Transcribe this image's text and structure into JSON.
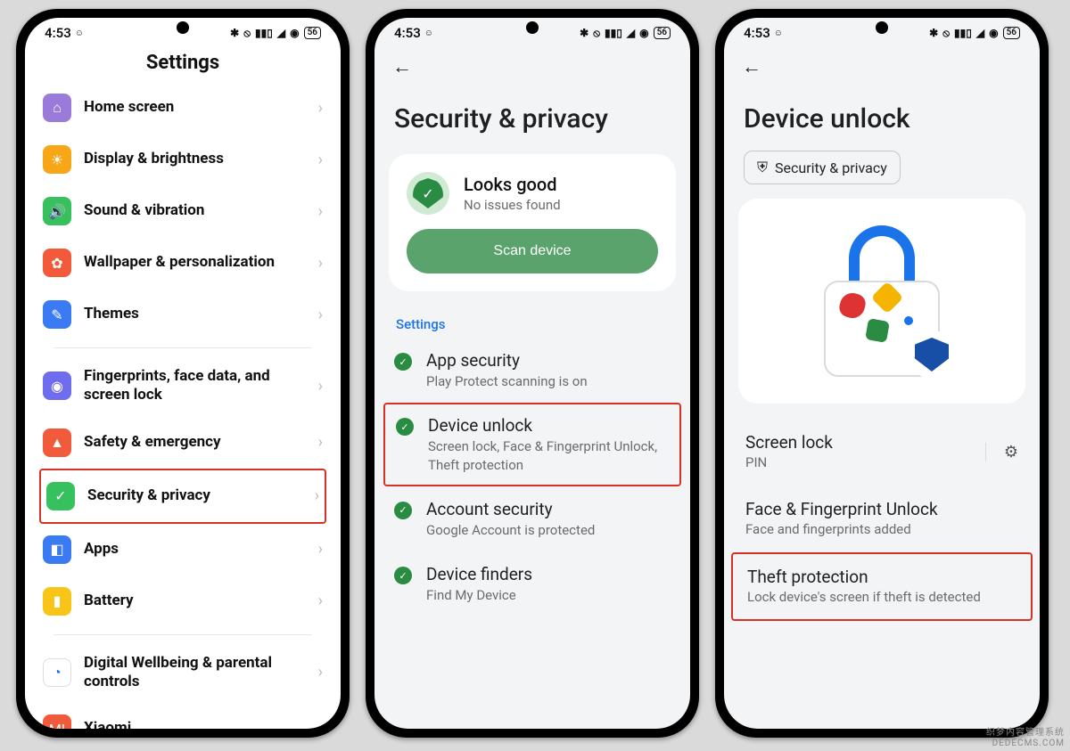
{
  "status": {
    "time": "4:53",
    "battery": "56"
  },
  "screen1": {
    "title": "Settings",
    "items": [
      {
        "label": "Home screen",
        "icon_bg": "#9b7bd9"
      },
      {
        "label": "Display & brightness",
        "icon_bg": "#f7a617"
      },
      {
        "label": "Sound & vibration",
        "icon_bg": "#37c15e"
      },
      {
        "label": "Wallpaper & personaliza­tion",
        "icon_bg": "#f15a3b"
      },
      {
        "label": "Themes",
        "icon_bg": "#3a7af2"
      },
      {
        "label": "Fingerprints, face data, and screen lock",
        "icon_bg": "#6f6cf0"
      },
      {
        "label": "Safety & emergency",
        "icon_bg": "#f15a3b"
      },
      {
        "label": "Security & privacy",
        "icon_bg": "#37c15e",
        "highlight": true
      },
      {
        "label": "Apps",
        "icon_bg": "#3a7af2"
      },
      {
        "label": "Battery",
        "icon_bg": "#f7c417"
      },
      {
        "label": "Digital Wellbeing & parental controls",
        "icon_bg": "#ffffff"
      },
      {
        "label": "Xiaomi",
        "icon_bg": "#f15a3b"
      }
    ]
  },
  "screen2": {
    "title": "Security & privacy",
    "card": {
      "title": "Looks good",
      "sub": "No issues found",
      "button": "Scan device"
    },
    "section": "Settings",
    "items": [
      {
        "label": "App security",
        "sub": "Play Protect scanning is on"
      },
      {
        "label": "Device unlock",
        "sub": "Screen lock, Face & Fingerprint Unlock, Theft protection",
        "highlight": true
      },
      {
        "label": "Account security",
        "sub": "Google Account is protected"
      },
      {
        "label": "Device finders",
        "sub": "Find My Device"
      }
    ]
  },
  "screen3": {
    "title": "Device unlock",
    "chip": "Security & privacy",
    "items": [
      {
        "label": "Screen lock",
        "sub": "PIN",
        "gear": true
      },
      {
        "label": "Face & Fingerprint Unlock",
        "sub": "Face and fingerprints added"
      },
      {
        "label": "Theft protection",
        "sub": "Lock device's screen if theft is detected",
        "highlight": true
      }
    ]
  },
  "watermark": {
    "l1": "织梦内容管理系统",
    "l2": "DEDECMS.COM"
  }
}
